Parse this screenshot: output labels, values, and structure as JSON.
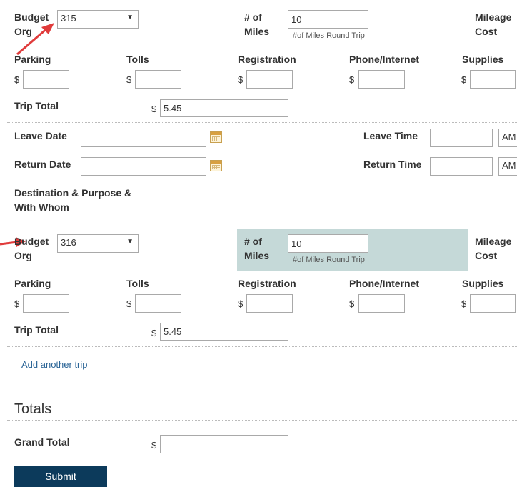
{
  "trips": [
    {
      "budget_org_label": "Budget Org",
      "budget_org_value": "315",
      "miles_label": "# of Miles",
      "miles_value": "10",
      "miles_hint": "#of Miles Round Trip",
      "mileage_cost_label": "Mileage Cost",
      "expenses": [
        "Parking",
        "Tolls",
        "Registration",
        "Phone/Internet",
        "Supplies"
      ],
      "currency": "$",
      "trip_total_label": "Trip Total",
      "trip_total_value": "5.45",
      "leave_date_label": "Leave Date",
      "leave_time_label": "Leave Time",
      "return_date_label": "Return Date",
      "return_time_label": "Return Time",
      "ampm_value": "AM",
      "destination_label": "Destination & Purpose & With Whom"
    },
    {
      "budget_org_label": "Budget Org",
      "budget_org_value": "316",
      "miles_label": "# of Miles",
      "miles_value": "10",
      "miles_hint": "#of Miles Round Trip",
      "mileage_cost_label": "Mileage Cost",
      "expenses": [
        "Parking",
        "Tolls",
        "Registration",
        "Phone/Internet",
        "Supplies"
      ],
      "currency": "$",
      "trip_total_label": "Trip Total",
      "trip_total_value": "5.45"
    }
  ],
  "add_trip_link": "Add another trip",
  "totals_heading": "Totals",
  "grand_total_label": "Grand Total",
  "grand_total_currency": "$",
  "submit_label": "Submit",
  "colors": {
    "arrow": "#e03b3b",
    "highlight": "#c5d9d8",
    "link": "#2a6496",
    "submit": "#0c3a5b"
  }
}
